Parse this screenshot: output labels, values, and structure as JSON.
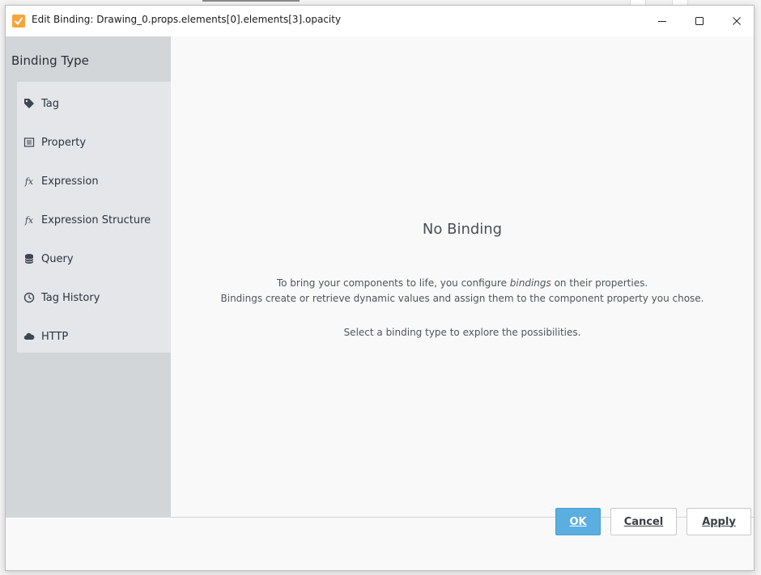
{
  "window": {
    "title": "Edit Binding: Drawing_0.props.elements[0].elements[3].opacity"
  },
  "sidebar": {
    "header": "Binding Type",
    "items": [
      {
        "label": "Tag",
        "icon": "tag-icon"
      },
      {
        "label": "Property",
        "icon": "property-icon"
      },
      {
        "label": "Expression",
        "icon": "fx-icon"
      },
      {
        "label": "Expression Structure",
        "icon": "fx-icon"
      },
      {
        "label": "Query",
        "icon": "database-icon"
      },
      {
        "label": "Tag History",
        "icon": "clock-icon"
      },
      {
        "label": "HTTP",
        "icon": "cloud-icon"
      }
    ]
  },
  "main": {
    "title": "No Binding",
    "desc_part1": "To bring your components to life, you configure ",
    "desc_em": "bindings",
    "desc_part2": " on their properties.",
    "desc_line2": "Bindings create or retrieve dynamic values and assign them to the component property you chose.",
    "hint": "Select a binding type to explore the possibilities."
  },
  "footer": {
    "ok_label": "OK",
    "cancel_label": "Cancel",
    "apply_label": "Apply"
  },
  "colors": {
    "accent": "#5aaee0",
    "sidebar_bg": "#d3d6d9",
    "list_bg": "#e4e6e9",
    "app_icon": "#f7a53a"
  }
}
